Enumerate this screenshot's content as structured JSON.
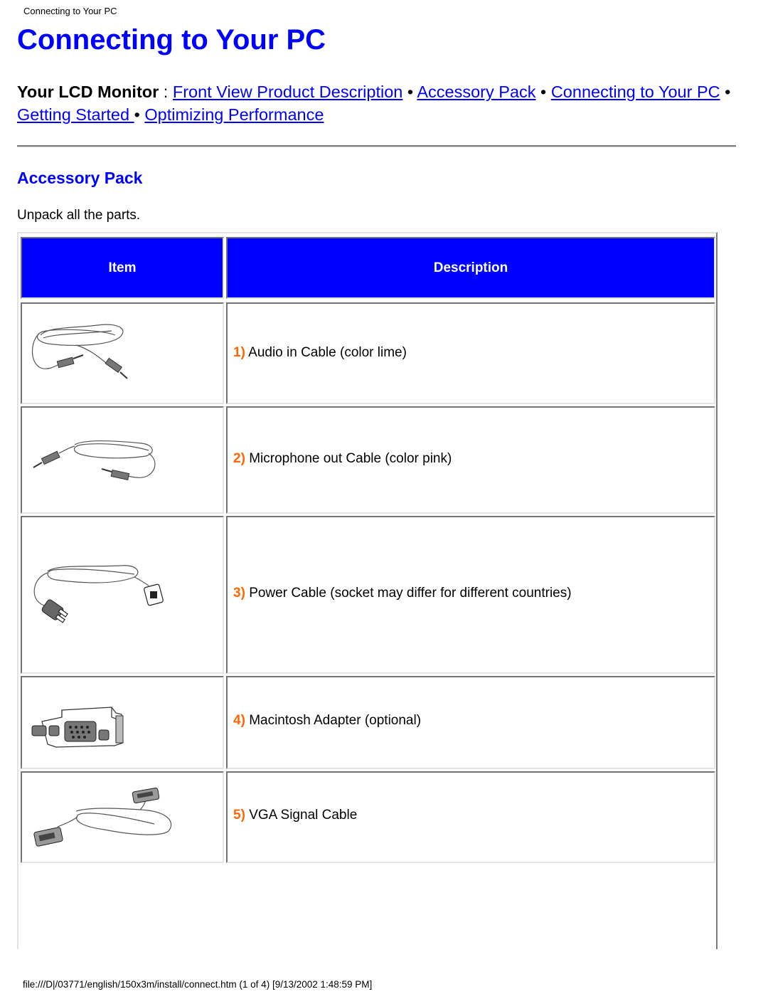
{
  "running_head": "Connecting to Your PC",
  "page_title": "Connecting to Your PC",
  "nav": {
    "lead": "Your LCD Monitor",
    "separator_colon": " : ",
    "bullet": " • ",
    "links": [
      {
        "label": "Front View Product Description"
      },
      {
        "label": "Accessory Pack"
      },
      {
        "label": "Connecting to Your PC"
      },
      {
        "label": "Getting Started "
      },
      {
        "label": "Optimizing Performance"
      }
    ]
  },
  "section": {
    "title": "Accessory Pack",
    "intro": "Unpack all the parts."
  },
  "colors": {
    "link": "#0000ff",
    "title": "#0000ff",
    "header_bg": "#0000ff",
    "number_accent": "#ff6600"
  },
  "table": {
    "columns": [
      "Item",
      "Description"
    ],
    "rows": [
      {
        "num": "1)",
        "text": "Audio in Cable (color lime)",
        "image": "audio-cable-icon"
      },
      {
        "num": "2)",
        "text": "Microphone out Cable (color pink)",
        "image": "microphone-cable-icon"
      },
      {
        "num": "3)",
        "text": "Power Cable (socket may differ for different countries)",
        "image": "power-cable-icon"
      },
      {
        "num": "4)",
        "text": "Macintosh Adapter (optional)",
        "image": "mac-adapter-icon"
      },
      {
        "num": "5)",
        "text": "VGA Signal Cable",
        "image": "vga-cable-icon"
      }
    ]
  },
  "footer": "file:///D|/03771/english/150x3m/install/connect.htm (1 of 4) [9/13/2002 1:48:59 PM]"
}
